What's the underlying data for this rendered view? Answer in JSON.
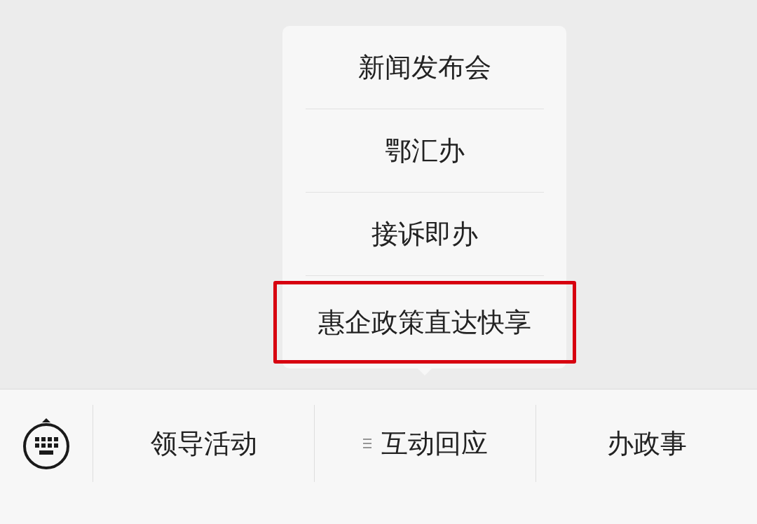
{
  "popup_menu": {
    "items": [
      {
        "label": "新闻发布会",
        "highlighted": false
      },
      {
        "label": "鄂汇办",
        "highlighted": false
      },
      {
        "label": "接诉即办",
        "highlighted": false
      },
      {
        "label": "惠企政策直达快享",
        "highlighted": true
      }
    ]
  },
  "menu_bar": {
    "tabs": [
      {
        "label": "领导活动",
        "expanded": false
      },
      {
        "label": "互动回应",
        "expanded": true
      },
      {
        "label": "办政事",
        "expanded": false
      }
    ]
  }
}
